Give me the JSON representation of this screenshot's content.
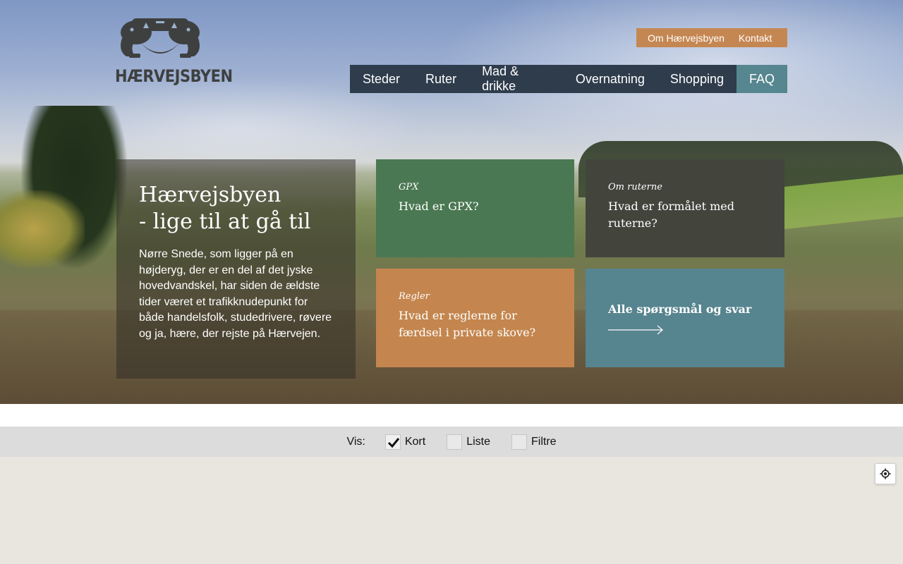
{
  "brand": {
    "logo_text": "HÆRVEJSBYEN",
    "logo_icon": "twin-lions-emblem-icon"
  },
  "utility_nav": [
    {
      "label": "Om Hærvejsbyen"
    },
    {
      "label": "Kontakt"
    }
  ],
  "main_nav": [
    {
      "label": "Steder"
    },
    {
      "label": "Ruter"
    },
    {
      "label": "Mad & drikke"
    },
    {
      "label": "Overnatning"
    },
    {
      "label": "Shopping"
    },
    {
      "label": "FAQ",
      "active": true
    }
  ],
  "intro": {
    "title_line1": "Hærvejsbyen",
    "title_line2": "- lige til at gå til",
    "body": "Nørre Snede, som ligger på en højderyg, der er en del af det jyske hovedvandskel, har siden de ældste tider været et trafikknudepunkt for både handelsfolk, studedrivere, røvere og ja, hære, der rejste på Hærvejen."
  },
  "faq_tiles": [
    {
      "category": "GPX",
      "question": "Hvad er GPX?",
      "color": "#4a7852"
    },
    {
      "category": "Om ruterne",
      "question": "Hvad er formålet med ruterne?",
      "color": "#43453d"
    },
    {
      "category": "Regler",
      "question": "Hvad er reglerne for færdsel i private skove?",
      "color": "#c4864e"
    },
    {
      "category": "",
      "question": "Alle spørgsmål og svar",
      "color": "#56848f"
    }
  ],
  "view_toggle": {
    "label": "Vis:",
    "options": [
      {
        "label": "Kort",
        "checked": true
      },
      {
        "label": "Liste",
        "checked": false
      },
      {
        "label": "Filtre",
        "checked": false
      }
    ]
  },
  "map": {
    "locate_icon": "locate-me-icon"
  },
  "colors": {
    "nav_bg": "#2f3c4c",
    "nav_active": "#56868f",
    "utility_bg": "#c58752"
  }
}
